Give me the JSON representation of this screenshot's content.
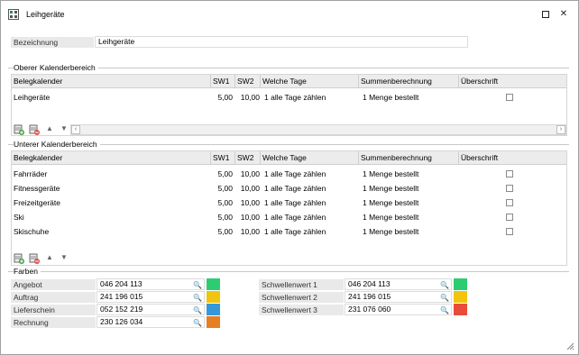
{
  "window": {
    "title": "Leihgeräte",
    "minimize": "—",
    "close": "✕"
  },
  "bezeichnung": {
    "label": "Bezeichnung",
    "value": "Leihgeräte"
  },
  "oberer": {
    "title": "Oberer Kalenderbereich",
    "headers": [
      "Belegkalender",
      "SW1",
      "SW2",
      "Welche Tage",
      "Summenberechnung",
      "Überschrift"
    ],
    "rows": [
      {
        "name": "Leihgeräte",
        "sw1": "5,00",
        "sw2": "10,00",
        "tage": "1  alle Tage zählen",
        "summe": "1  Menge bestellt",
        "ueberschrift": false
      }
    ]
  },
  "unterer": {
    "title": "Unterer Kalenderbereich",
    "headers": [
      "Belegkalender",
      "SW1",
      "SW2",
      "Welche Tage",
      "Summenberechnung",
      "Überschrift"
    ],
    "rows": [
      {
        "name": "Fahrräder",
        "sw1": "5,00",
        "sw2": "10,00",
        "tage": "1  alle Tage zählen",
        "summe": "1  Menge bestellt",
        "ueberschrift": false
      },
      {
        "name": "Fitnessgeräte",
        "sw1": "5,00",
        "sw2": "10,00",
        "tage": "1  alle Tage zählen",
        "summe": "1  Menge bestellt",
        "ueberschrift": false
      },
      {
        "name": "Freizeitgeräte",
        "sw1": "5,00",
        "sw2": "10,00",
        "tage": "1  alle Tage zählen",
        "summe": "1  Menge bestellt",
        "ueberschrift": false
      },
      {
        "name": "Ski",
        "sw1": "5,00",
        "sw2": "10,00",
        "tage": "1  alle Tage zählen",
        "summe": "1  Menge bestellt",
        "ueberschrift": false
      },
      {
        "name": "Skischuhe",
        "sw1": "5,00",
        "sw2": "10,00",
        "tage": "1  alle Tage zählen",
        "summe": "1  Menge bestellt",
        "ueberschrift": false
      }
    ]
  },
  "farben": {
    "title": "Farben",
    "left": [
      {
        "label": "Angebot",
        "value": "046 204 113",
        "color": "#2ecc71"
      },
      {
        "label": "Auftrag",
        "value": "241 196 015",
        "color": "#f1c40f"
      },
      {
        "label": "Lieferschein",
        "value": "052 152 219",
        "color": "#3498db"
      },
      {
        "label": "Rechnung",
        "value": "230 126 034",
        "color": "#e67e22"
      }
    ],
    "right": [
      {
        "label": "Schwellenwert 1",
        "value": "046 204 113",
        "color": "#2ecc71"
      },
      {
        "label": "Schwellenwert 2",
        "value": "241 196 015",
        "color": "#f1c40f"
      },
      {
        "label": "Schwellenwert 3",
        "value": "231 076 060",
        "color": "#e74c3c"
      }
    ]
  },
  "icons": {
    "app": "calendar-grid-icon",
    "search": "magnifier-icon",
    "toolbar": [
      "add-row-icon",
      "delete-row-icon",
      "move-up-icon",
      "move-down-icon"
    ],
    "scroll_left": "‹",
    "scroll_right": "›",
    "up": "▲",
    "down": "▼"
  }
}
